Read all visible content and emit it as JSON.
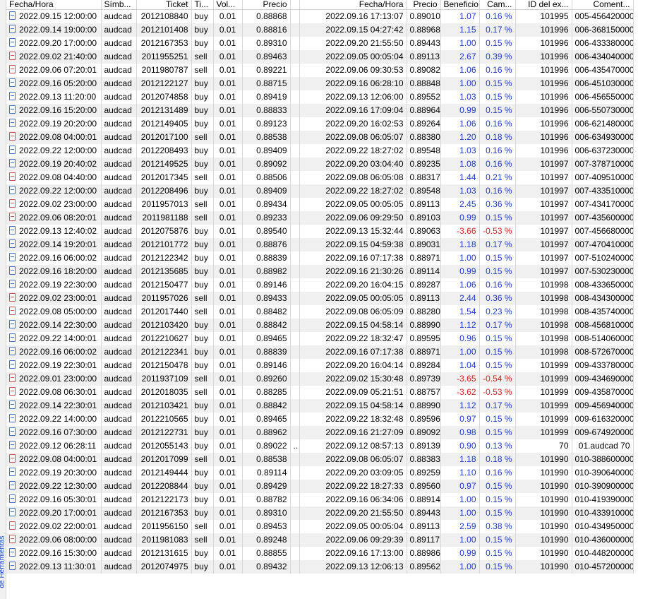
{
  "sidebar": {
    "label": "de Herramientas"
  },
  "headers": [
    "Fecha/Hora",
    "Símb...",
    "Ticket",
    "Ti...",
    "Vol...",
    "Precio",
    "",
    "Fecha/Hora",
    "Precio",
    "Beneficio",
    "Cam...",
    "ID del ex...",
    "Coment..."
  ],
  "rows": [
    [
      "2022.09.15 12:00:00",
      "audcad",
      "2012108840",
      "buy",
      "0.01",
      "0.88868",
      "",
      "2022.09.16 17:13:07",
      "0.89010",
      "1.07",
      "0.16 %",
      "101995",
      "005-456420000"
    ],
    [
      "2022.09.14 19:00:00",
      "audcad",
      "2012101408",
      "buy",
      "0.01",
      "0.88816",
      "",
      "2022.09.15 04:27:42",
      "0.88968",
      "1.15",
      "0.17 %",
      "101996",
      "006-368150000"
    ],
    [
      "2022.09.20 17:00:00",
      "audcad",
      "2012167353",
      "buy",
      "0.01",
      "0.89310",
      "",
      "2022.09.20 21:55:50",
      "0.89443",
      "1.00",
      "0.15 %",
      "101996",
      "006-433380000"
    ],
    [
      "2022.09.02 21:40:00",
      "audcad",
      "2011955251",
      "sell",
      "0.01",
      "0.89463",
      "",
      "2022.09.05 00:05:04",
      "0.89113",
      "2.67",
      "0.39 %",
      "101996",
      "006-434040000"
    ],
    [
      "2022.09.06 07:20:01",
      "audcad",
      "2011980787",
      "sell",
      "0.01",
      "0.89221",
      "",
      "2022.09.06 09:30:53",
      "0.89082",
      "1.06",
      "0.16 %",
      "101996",
      "006-435470000"
    ],
    [
      "2022.09.16 05:20:00",
      "audcad",
      "2012122127",
      "buy",
      "0.01",
      "0.88715",
      "",
      "2022.09.16 06:28:10",
      "0.88848",
      "1.00",
      "0.15 %",
      "101996",
      "006-451030000"
    ],
    [
      "2022.09.13 11:20:00",
      "audcad",
      "2012074858",
      "buy",
      "0.01",
      "0.89419",
      "",
      "2022.09.13 12:06:00",
      "0.89552",
      "1.03",
      "0.15 %",
      "101996",
      "006-456550000"
    ],
    [
      "2022.09.16 15:20:00",
      "audcad",
      "2012131489",
      "buy",
      "0.01",
      "0.88833",
      "",
      "2022.09.16 17:09:04",
      "0.88964",
      "0.99",
      "0.15 %",
      "101996",
      "006-550730000"
    ],
    [
      "2022.09.19 20:20:00",
      "audcad",
      "2012149405",
      "buy",
      "0.01",
      "0.89123",
      "",
      "2022.09.20 16:02:53",
      "0.89264",
      "1.06",
      "0.16 %",
      "101996",
      "006-621480000"
    ],
    [
      "2022.09.08 04:00:01",
      "audcad",
      "2012017100",
      "sell",
      "0.01",
      "0.88538",
      "",
      "2022.09.08 06:05:07",
      "0.88380",
      "1.20",
      "0.18 %",
      "101996",
      "006-634930000"
    ],
    [
      "2022.09.22 12:00:00",
      "audcad",
      "2012208493",
      "buy",
      "0.01",
      "0.89409",
      "",
      "2022.09.22 18:27:02",
      "0.89548",
      "1.03",
      "0.16 %",
      "101996",
      "006-637230000"
    ],
    [
      "2022.09.19 20:40:02",
      "audcad",
      "2012149525",
      "buy",
      "0.01",
      "0.89092",
      "",
      "2022.09.20 03:04:40",
      "0.89235",
      "1.08",
      "0.16 %",
      "101997",
      "007-378710000"
    ],
    [
      "2022.09.08 04:40:00",
      "audcad",
      "2012017345",
      "sell",
      "0.01",
      "0.88506",
      "",
      "2022.09.08 06:05:08",
      "0.88317",
      "1.44",
      "0.21 %",
      "101997",
      "007-409510000"
    ],
    [
      "2022.09.22 12:00:00",
      "audcad",
      "2012208496",
      "buy",
      "0.01",
      "0.89409",
      "",
      "2022.09.22 18:27:02",
      "0.89548",
      "1.03",
      "0.16 %",
      "101997",
      "007-433510000"
    ],
    [
      "2022.09.02 23:00:00",
      "audcad",
      "2011957013",
      "sell",
      "0.01",
      "0.89434",
      "",
      "2022.09.05 00:05:05",
      "0.89113",
      "2.45",
      "0.36 %",
      "101997",
      "007-434170000"
    ],
    [
      "2022.09.06 08:20:01",
      "audcad",
      "2011981188",
      "sell",
      "0.01",
      "0.89233",
      "",
      "2022.09.06 09:29:50",
      "0.89103",
      "0.99",
      "0.15 %",
      "101997",
      "007-435600000"
    ],
    [
      "2022.09.13 12:40:02",
      "audcad",
      "2012075876",
      "buy",
      "0.01",
      "0.89540",
      "",
      "2022.09.13 15:32:44",
      "0.89063",
      "-3.66",
      "-0.53 %",
      "101997",
      "007-456680000"
    ],
    [
      "2022.09.14 19:20:01",
      "audcad",
      "2012101772",
      "buy",
      "0.01",
      "0.88876",
      "",
      "2022.09.15 04:59:38",
      "0.89031",
      "1.18",
      "0.17 %",
      "101997",
      "007-470410000"
    ],
    [
      "2022.09.16 06:00:02",
      "audcad",
      "2012122342",
      "buy",
      "0.01",
      "0.88839",
      "",
      "2022.09.16 07:17:38",
      "0.88971",
      "1.00",
      "0.15 %",
      "101997",
      "007-510240000"
    ],
    [
      "2022.09.16 18:20:00",
      "audcad",
      "2012135685",
      "buy",
      "0.01",
      "0.88982",
      "",
      "2022.09.16 21:30:26",
      "0.89114",
      "0.99",
      "0.15 %",
      "101997",
      "007-530230000"
    ],
    [
      "2022.09.19 22:30:00",
      "audcad",
      "2012150477",
      "buy",
      "0.01",
      "0.89146",
      "",
      "2022.09.20 16:04:15",
      "0.89287",
      "1.06",
      "0.16 %",
      "101998",
      "008-433650000"
    ],
    [
      "2022.09.02 23:00:01",
      "audcad",
      "2011957026",
      "sell",
      "0.01",
      "0.89433",
      "",
      "2022.09.05 00:05:05",
      "0.89113",
      "2.44",
      "0.36 %",
      "101998",
      "008-434300000"
    ],
    [
      "2022.09.08 05:00:00",
      "audcad",
      "2012017440",
      "sell",
      "0.01",
      "0.88482",
      "",
      "2022.09.08 06:05:09",
      "0.88280",
      "1.54",
      "0.23 %",
      "101998",
      "008-435740000"
    ],
    [
      "2022.09.14 22:30:00",
      "audcad",
      "2012103420",
      "buy",
      "0.01",
      "0.88842",
      "",
      "2022.09.15 04:58:14",
      "0.88990",
      "1.12",
      "0.17 %",
      "101998",
      "008-456810000"
    ],
    [
      "2022.09.22 14:00:01",
      "audcad",
      "2012210627",
      "buy",
      "0.01",
      "0.89465",
      "",
      "2022.09.22 18:32:47",
      "0.89595",
      "0.96",
      "0.15 %",
      "101998",
      "008-514060000"
    ],
    [
      "2022.09.16 06:00:02",
      "audcad",
      "2012122341",
      "buy",
      "0.01",
      "0.88839",
      "",
      "2022.09.16 07:17:38",
      "0.88971",
      "1.00",
      "0.15 %",
      "101998",
      "008-572670000"
    ],
    [
      "2022.09.19 22:30:01",
      "audcad",
      "2012150478",
      "buy",
      "0.01",
      "0.89146",
      "",
      "2022.09.20 16:04:14",
      "0.89284",
      "1.04",
      "0.15 %",
      "101999",
      "009-433780000"
    ],
    [
      "2022.09.01 23:00:00",
      "audcad",
      "2011937109",
      "sell",
      "0.01",
      "0.89260",
      "",
      "2022.09.02 15:30:48",
      "0.89739",
      "-3.65",
      "-0.54 %",
      "101999",
      "009-434690000"
    ],
    [
      "2022.09.08 06:30:01",
      "audcad",
      "2012018035",
      "sell",
      "0.01",
      "0.88285",
      "",
      "2022.09.09 05:21:51",
      "0.88757",
      "-3.62",
      "-0.53 %",
      "101999",
      "009-435870000"
    ],
    [
      "2022.09.14 22:30:01",
      "audcad",
      "2012103421",
      "buy",
      "0.01",
      "0.88842",
      "",
      "2022.09.15 04:58:14",
      "0.88990",
      "1.12",
      "0.17 %",
      "101999",
      "009-456940000"
    ],
    [
      "2022.09.22 14:00:00",
      "audcad",
      "2012210565",
      "buy",
      "0.01",
      "0.89465",
      "",
      "2022.09.22 18:32:48",
      "0.89596",
      "0.97",
      "0.15 %",
      "101999",
      "009-616320000"
    ],
    [
      "2022.09.16 07:30:00",
      "audcad",
      "2012122731",
      "buy",
      "0.01",
      "0.88962",
      "",
      "2022.09.16 21:27:09",
      "0.89092",
      "0.98",
      "0.15 %",
      "101999",
      "009-674920000"
    ],
    [
      "2022.09.12 06:28:11",
      "audcad",
      "2012055143",
      "buy",
      "0.01",
      "0.89022",
      "..",
      "2022.09.12 08:57:13",
      "0.89139",
      "0.90",
      "0.13 %",
      "70",
      "01.audcad 70"
    ],
    [
      "2022.09.08 04:00:01",
      "audcad",
      "2012017099",
      "sell",
      "0.01",
      "0.88538",
      "",
      "2022.09.08 06:05:07",
      "0.88383",
      "1.18",
      "0.18 %",
      "101990",
      "010-388600000"
    ],
    [
      "2022.09.19 20:30:00",
      "audcad",
      "2012149444",
      "buy",
      "0.01",
      "0.89114",
      "",
      "2022.09.20 03:09:05",
      "0.89259",
      "1.10",
      "0.16 %",
      "101990",
      "010-390640000"
    ],
    [
      "2022.09.22 12:30:00",
      "audcad",
      "2012208844",
      "buy",
      "0.01",
      "0.89429",
      "",
      "2022.09.22 18:27:33",
      "0.89560",
      "0.97",
      "0.15 %",
      "101990",
      "010-390900000"
    ],
    [
      "2022.09.16 05:30:01",
      "audcad",
      "2012122173",
      "buy",
      "0.01",
      "0.88782",
      "",
      "2022.09.16 06:34:06",
      "0.88914",
      "1.00",
      "0.15 %",
      "101990",
      "010-419390000"
    ],
    [
      "2022.09.20 17:00:01",
      "audcad",
      "2012167353",
      "buy",
      "0.01",
      "0.89310",
      "",
      "2022.09.20 21:55:50",
      "0.89443",
      "1.00",
      "0.15 %",
      "101990",
      "010-433910000"
    ],
    [
      "2022.09.02 22:00:01",
      "audcad",
      "2011956150",
      "sell",
      "0.01",
      "0.89453",
      "",
      "2022.09.05 00:05:04",
      "0.89113",
      "2.59",
      "0.38 %",
      "101990",
      "010-434950000"
    ],
    [
      "2022.09.06 08:00:00",
      "audcad",
      "2011981083",
      "sell",
      "0.01",
      "0.89248",
      "",
      "2022.09.06 09:29:39",
      "0.89117",
      "1.00",
      "0.15 %",
      "101990",
      "010-436000000"
    ],
    [
      "2022.09.16 15:30:00",
      "audcad",
      "2012131615",
      "buy",
      "0.01",
      "0.88855",
      "",
      "2022.09.16 17:13:00",
      "0.88986",
      "0.99",
      "0.15 %",
      "101990",
      "010-448200000"
    ],
    [
      "2022.09.13 11:30:01",
      "audcad",
      "2012074975",
      "buy",
      "0.01",
      "0.89432",
      "",
      "2022.09.13 12:06:13",
      "0.89562",
      "1.00",
      "0.15 %",
      "101990",
      "010-457200000"
    ]
  ],
  "colors": {
    "positive": "#1c39d6",
    "negative": "#e02020",
    "marker": "#22c05a"
  }
}
